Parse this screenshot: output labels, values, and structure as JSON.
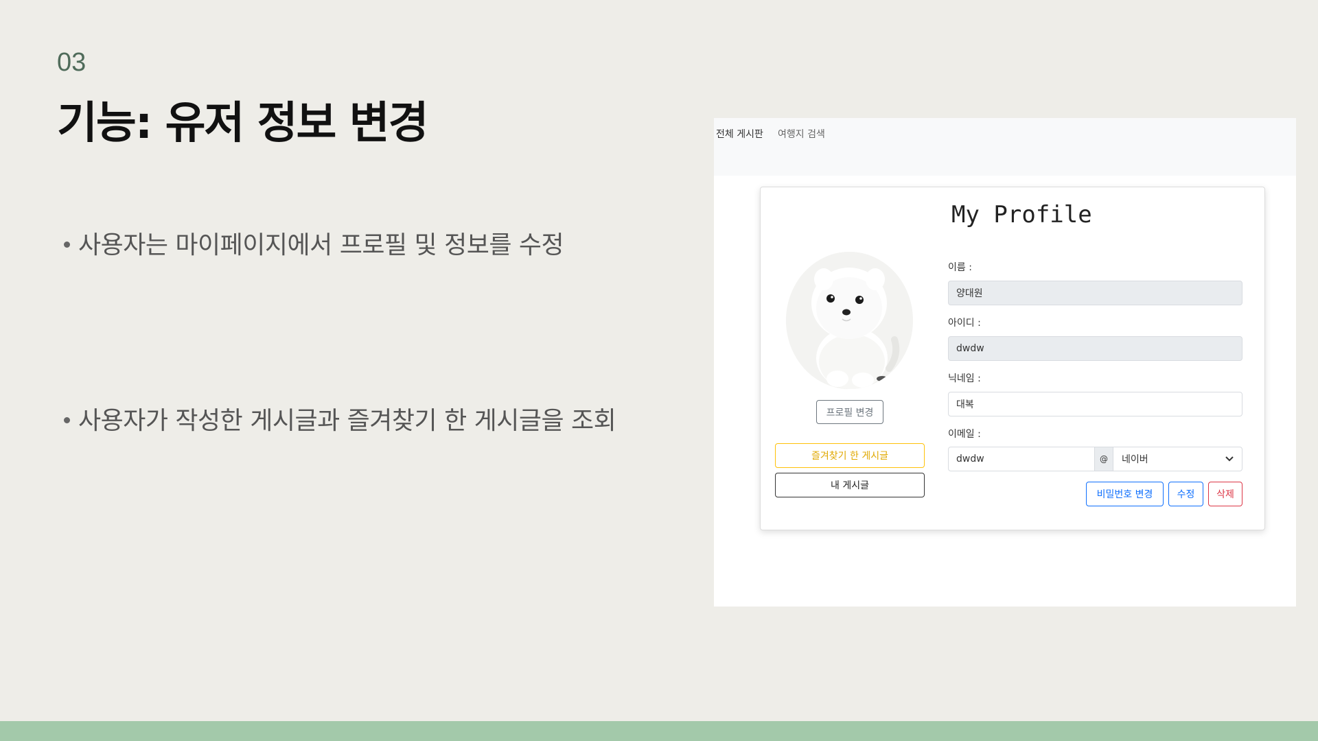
{
  "slide": {
    "number": "03",
    "title": "기능: 유저 정보 변경",
    "bullets": [
      "사용자는 마이페이지에서 프로필 및 정보를 수정",
      "사용자가 작성한 게시글과 즐겨찾기 한 게시글을 조회"
    ]
  },
  "app": {
    "nav": {
      "items": [
        "전체 게시판",
        "여행지 검색"
      ]
    },
    "profile": {
      "title": "My Profile",
      "change_photo_label": "프로필 변경",
      "favorites_label": "즐겨찾기 한 게시글",
      "my_posts_label": "내 게시글",
      "avatar_icon": "pomeranian-puppy-photo"
    },
    "form": {
      "name_label": "이름 :",
      "name_value": "양대원",
      "id_label": "아이디 :",
      "id_value": "dwdw",
      "nickname_label": "닉네임 :",
      "nickname_value": "대복",
      "email_label": "이메일 :",
      "email_local": "dwdw",
      "email_at": "@",
      "email_domain": "네이버"
    },
    "actions": {
      "change_password": "비밀번호 변경",
      "edit": "수정",
      "delete": "삭제"
    },
    "colors": {
      "primary": "#0d6efd",
      "danger": "#dc3545",
      "warning": "#ffc107",
      "accent_bar": "#a3c9aa"
    }
  }
}
